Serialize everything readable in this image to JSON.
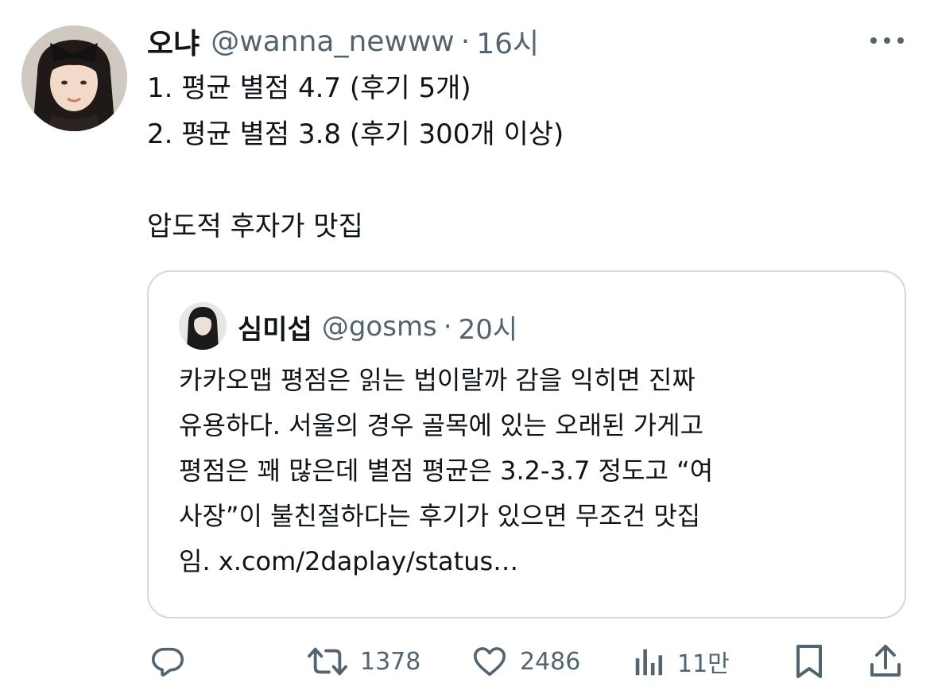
{
  "tweet": {
    "display_name": "오냐",
    "handle": "@wanna_newww",
    "separator": "·",
    "time": "16시",
    "lines": [
      "1. 평균 별점 4.7 (후기 5개)",
      "2. 평균 별점 3.8 (후기 300개 이상)",
      "",
      "압도적 후자가 맛집"
    ]
  },
  "quoted_tweet": {
    "display_name": "심미섭",
    "handle": "@gosms",
    "separator": "·",
    "time": "20시",
    "lines": [
      "카카오맵 평점은 읽는 법이랄까 감을 익히면 진짜",
      "유용하다. 서울의 경우 골목에 있는 오래된 가게고",
      "평점은 꽤 많은데 별점 평균은 3.2-3.7 정도고 “여",
      "사장”이 불친절하다는 후기가 있으면 무조건 맛집",
      "임. x.com/2daplay/status…"
    ]
  },
  "actions": {
    "reply": {
      "icon": "reply-icon"
    },
    "retweet": {
      "icon": "retweet-icon",
      "count": "1378"
    },
    "like": {
      "icon": "heart-icon",
      "count": "2486"
    },
    "views": {
      "icon": "views-icon",
      "count": "11만"
    },
    "bookmark": {
      "icon": "bookmark-icon"
    },
    "share": {
      "icon": "share-icon"
    }
  },
  "colors": {
    "text": "#0f1419",
    "secondary": "#536471",
    "border": "#cfd9de",
    "background": "#ffffff"
  }
}
